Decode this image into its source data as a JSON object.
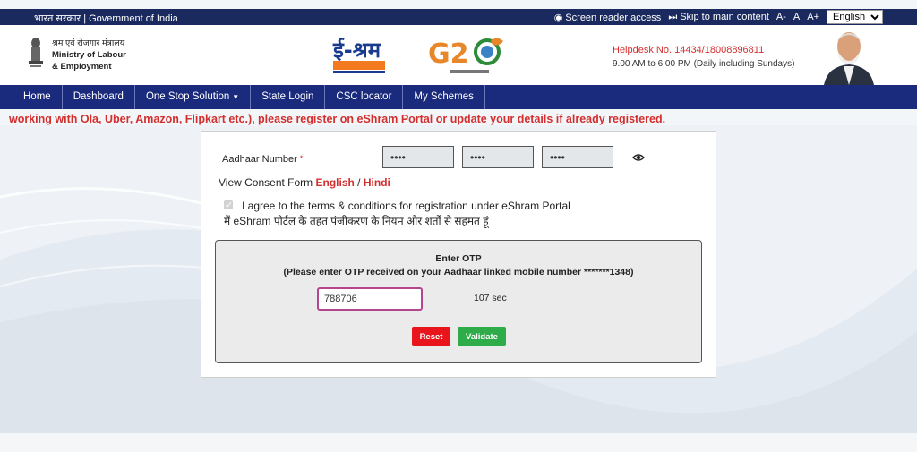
{
  "gov_bar": {
    "left_text": "भारत सरकार | Government of India",
    "screen_reader": "Screen reader access",
    "skip_main": "Skip to main content",
    "font_small": "A-",
    "font_normal": "A",
    "font_large": "A+",
    "language": "English"
  },
  "header": {
    "ministry_hi": "श्रम एवं रोजगार मंत्रालय",
    "ministry_en_1": "Ministry of Labour",
    "ministry_en_2": "& Employment",
    "helpdesk": "Helpdesk No. 14434/18008896811",
    "hours": "9.00 AM to 6.00 PM (Daily including Sundays)"
  },
  "nav": {
    "items": [
      "Home",
      "Dashboard",
      "One Stop Solution",
      "State Login",
      "CSC locator",
      "My Schemes"
    ]
  },
  "marquee": "working with Ola, Uber, Amazon, Flipkart etc.), please register on eShram Portal or update your details if already registered.",
  "form": {
    "aadhaar_label": "Aadhaar Number",
    "required_mark": "*",
    "aadhaar_parts": [
      "••••",
      "••••",
      "••••"
    ],
    "consent_prefix": "View Consent Form ",
    "consent_english": "English",
    "consent_sep": " / ",
    "consent_hindi": "Hindi",
    "agree_en": "I agree to the terms & conditions for registration under eShram Portal",
    "agree_hi": "मैं eShram पोर्टल के तहत पंजीकरण के नियम और शर्तों से सहमत हूं"
  },
  "otp": {
    "title": "Enter OTP",
    "subtitle": "(Please enter OTP received on your Aadhaar linked mobile number *******1348)",
    "value": "788706",
    "timer": "107 sec",
    "reset_label": "Reset",
    "validate_label": "Validate"
  },
  "colors": {
    "nav_bg": "#1a2a7c",
    "gov_bar_bg": "#1a2a5e",
    "accent_red": "#d32f2f",
    "validate_green": "#2eac4a",
    "reset_red": "#e8161c"
  }
}
